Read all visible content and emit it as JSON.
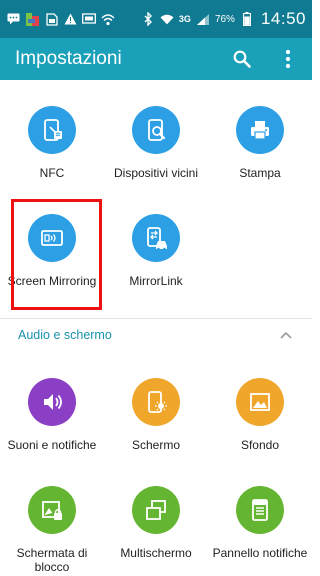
{
  "status_bar": {
    "network_type": "3G",
    "battery_percent": "76%",
    "time": "14:50",
    "icons_left": [
      "message-icon",
      "app-icon",
      "sim-icon",
      "alert-icon",
      "screen-icon",
      "wifi-call-icon"
    ],
    "icons_right": [
      "bluetooth-icon",
      "wifi-icon",
      "signal-icon",
      "battery-icon"
    ]
  },
  "app_bar": {
    "title": "Impostazioni",
    "actions": [
      "search-icon",
      "more-vert-icon"
    ]
  },
  "connections": [
    {
      "label": "NFC",
      "icon": "nfc-icon",
      "color": "#2d9fe4"
    },
    {
      "label": "Dispositivi vicini",
      "icon": "nearby-devices-icon",
      "color": "#2d9fe4"
    },
    {
      "label": "Stampa",
      "icon": "printer-icon",
      "color": "#2d9fe4"
    },
    {
      "label": "Screen Mirroring",
      "icon": "screen-mirroring-icon",
      "color": "#2d9fe4"
    },
    {
      "label": "MirrorLink",
      "icon": "mirrorlink-icon",
      "color": "#2d9fe4"
    }
  ],
  "section": {
    "title": "Audio e schermo",
    "expanded": true
  },
  "audio_display": [
    {
      "label": "Suoni e notifiche",
      "icon": "volume-icon",
      "color": "#8a3fc4"
    },
    {
      "label": "Schermo",
      "icon": "display-brightness-icon",
      "color": "#f0a62b"
    },
    {
      "label": "Sfondo",
      "icon": "wallpaper-icon",
      "color": "#f0a62b"
    },
    {
      "label": "Schermata di blocco",
      "icon": "lockscreen-icon",
      "color": "#64b532"
    },
    {
      "label": "Multischermo",
      "icon": "multiwindow-icon",
      "color": "#64b532"
    },
    {
      "label": "Pannello notifiche",
      "icon": "notification-panel-icon",
      "color": "#64b532"
    }
  ],
  "colors": {
    "status_bar": "#0f7a91",
    "app_bar": "#1aa0b8",
    "section_title": "#1a93ac",
    "highlight": "#ee1111"
  }
}
